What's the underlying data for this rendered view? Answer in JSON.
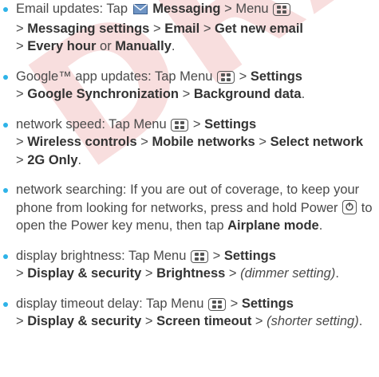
{
  "watermark": "DRAFT",
  "accent_color": "#2eb3e8",
  "icons": [
    "messaging-icon",
    "menu-key-icon",
    "power-key-icon"
  ],
  "tips": [
    {
      "lead": "Email updates: Tap",
      "messaging": "Messaging",
      "s1": "> Menu",
      "s2": ">",
      "messaging_settings": "Messaging settings",
      "s3": ">",
      "email": "Email",
      "s4": ">",
      "get_new_email": "Get new email",
      "s5": ">",
      "every_hour": "Every hour",
      "or": "or",
      "manually": "Manually",
      "end": "."
    },
    {
      "lead": "Google™ app updates: Tap Menu",
      "s1": ">",
      "settings": "Settings",
      "s2": ">",
      "google_sync": "Google Synchronization",
      "s3": ">",
      "background_data": "Background data",
      "end": "."
    },
    {
      "lead": "network speed: Tap Menu",
      "s1": ">",
      "settings": "Settings",
      "s2": ">",
      "wireless": "Wireless controls",
      "s3": ">",
      "mobile_networks": "Mobile networks",
      "s4": ">",
      "select_network": "Select network",
      "s5": ">",
      "two_g": "2G Only",
      "end": "."
    },
    {
      "lead": "network searching: If you are out of coverage, to keep your phone from looking for networks, press and hold Power",
      "mid": "to open the Power key menu, then tap",
      "airplane": "Airplane mode",
      "end": "."
    },
    {
      "lead": "display brightness: Tap Menu",
      "s1": ">",
      "settings": "Settings",
      "s2": ">",
      "display_security": "Display & security",
      "s3": ">",
      "brightness": "Brightness",
      "s4": ">",
      "dimmer": "(dimmer setting)",
      "end": "."
    },
    {
      "lead": "display timeout delay: Tap Menu",
      "s1": ">",
      "settings": "Settings",
      "s2": ">",
      "display_security": "Display & security",
      "s3": ">",
      "screen_timeout": "Screen timeout",
      "s4": ">",
      "shorter": "(shorter setting)",
      "end": "."
    }
  ]
}
